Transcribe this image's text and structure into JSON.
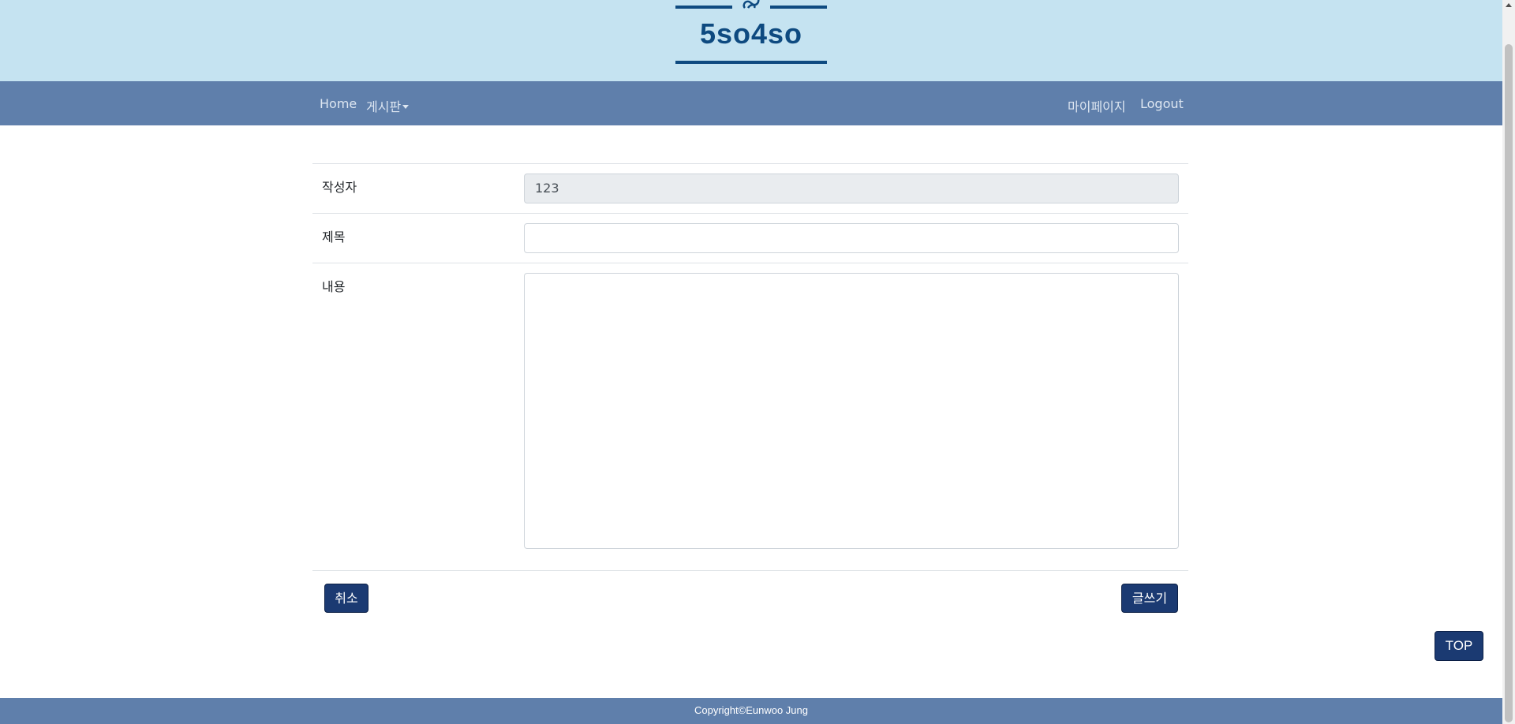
{
  "header": {
    "logo_text": "5so4so",
    "logo_mark_icon": "knot-icon"
  },
  "nav": {
    "home": "Home",
    "board": "게시판",
    "mypage": "마이페이지",
    "logout": "Logout"
  },
  "form": {
    "writer_label": "작성자",
    "writer_value": "123",
    "title_label": "제목",
    "title_value": "",
    "content_label": "내용",
    "content_value": ""
  },
  "buttons": {
    "cancel": "취소",
    "write": "글쓰기",
    "top": "TOP"
  },
  "footer": {
    "copyright": "Copyright©Eunwoo Jung"
  },
  "colors": {
    "banner": "#c5e3f1",
    "navbar": "#5f7fab",
    "brand": "#0e4a80",
    "button": "#1b3a72"
  }
}
